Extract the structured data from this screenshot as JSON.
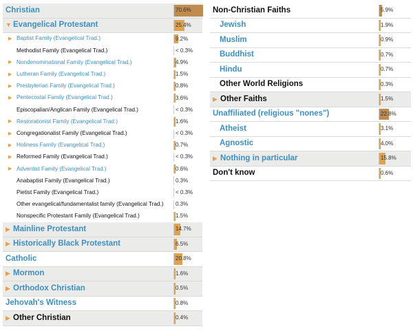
{
  "left_rows": [
    {
      "label": "Christian",
      "value": "70.6%",
      "pct": 70.6,
      "arrow": false,
      "style": "blue",
      "level": 0,
      "shaded": true,
      "bar": "dark"
    },
    {
      "label": "Evangelical Protestant",
      "value": "25.4%",
      "pct": 25.4,
      "arrow": true,
      "arrow_glyph": "▼",
      "style": "blue",
      "level": 0,
      "shaded": true,
      "bar": "light"
    },
    {
      "label": "Baptist Family (Evangelical Trad.)",
      "value": "9.2%",
      "pct": 9.2,
      "arrow": true,
      "arrow_glyph": "▶",
      "style": "blue",
      "level": 1,
      "shaded": false,
      "bar": "light"
    },
    {
      "label": "Methodist Family (Evangelical Trad.)",
      "value": "< 0.3%",
      "pct": 0.1,
      "arrow": false,
      "style": "black",
      "level": 1,
      "shaded": false,
      "bar": "none"
    },
    {
      "label": "Nondenominational Family (Evangelical Trad.)",
      "value": "4.9%",
      "pct": 4.9,
      "arrow": true,
      "arrow_glyph": "▶",
      "style": "blue",
      "level": 1,
      "shaded": false,
      "bar": "light"
    },
    {
      "label": "Lutheran Family (Evangelical Trad.)",
      "value": "1.5%",
      "pct": 1.5,
      "arrow": true,
      "arrow_glyph": "▶",
      "style": "blue",
      "level": 1,
      "shaded": false,
      "bar": "light"
    },
    {
      "label": "Presbyterian Family (Evangelical Trad.)",
      "value": "0.8%",
      "pct": 0.8,
      "arrow": true,
      "arrow_glyph": "▶",
      "style": "blue",
      "level": 1,
      "shaded": false,
      "bar": "light"
    },
    {
      "label": "Pentecostal Family (Evangelical Trad.)",
      "value": "3.6%",
      "pct": 3.6,
      "arrow": true,
      "arrow_glyph": "▶",
      "style": "blue",
      "level": 1,
      "shaded": false,
      "bar": "light"
    },
    {
      "label": "Episcopalian/Anglican Family (Evangelical Trad.)",
      "value": "< 0.3%",
      "pct": 0.1,
      "arrow": false,
      "style": "black",
      "level": 1,
      "shaded": false,
      "bar": "none"
    },
    {
      "label": "Restorationist Family (Evangelical Trad.)",
      "value": "1.6%",
      "pct": 1.6,
      "arrow": true,
      "arrow_glyph": "▶",
      "style": "blue",
      "level": 1,
      "shaded": false,
      "bar": "light"
    },
    {
      "label": "Congregationalist Family (Evangelical Trad.)",
      "value": "< 0.3%",
      "pct": 0.1,
      "arrow": true,
      "arrow_glyph": "▶",
      "style": "black",
      "level": 1,
      "shaded": false,
      "bar": "none"
    },
    {
      "label": "Holiness Family (Evangelical Trad.)",
      "value": "0.7%",
      "pct": 0.7,
      "arrow": true,
      "arrow_glyph": "▶",
      "style": "blue",
      "level": 1,
      "shaded": false,
      "bar": "light"
    },
    {
      "label": "Reformed Family (Evangelical Trad.)",
      "value": "< 0.3%",
      "pct": 0.1,
      "arrow": true,
      "arrow_glyph": "▶",
      "style": "black",
      "level": 1,
      "shaded": false,
      "bar": "none"
    },
    {
      "label": "Adventist Family (Evangelical Trad.)",
      "value": "0.6%",
      "pct": 0.6,
      "arrow": true,
      "arrow_glyph": "▶",
      "style": "blue",
      "level": 1,
      "shaded": false,
      "bar": "light"
    },
    {
      "label": "Anabaptist Family (Evangelical Trad.)",
      "value": "0.3%",
      "pct": 0.3,
      "arrow": false,
      "style": "black",
      "level": 1,
      "shaded": false,
      "bar": "none"
    },
    {
      "label": "Pietist Family (Evangelical Trad.)",
      "value": "< 0.3%",
      "pct": 0.1,
      "arrow": false,
      "style": "black",
      "level": 1,
      "shaded": false,
      "bar": "none"
    },
    {
      "label": "Other evangelical/fundamentalist family (Evangelical Trad.)",
      "value": "0.3%",
      "pct": 0.3,
      "arrow": false,
      "style": "black",
      "level": 1,
      "shaded": false,
      "bar": "none"
    },
    {
      "label": "Nonspecific Protestant Family (Evangelical Trad.)",
      "value": "1.5%",
      "pct": 1.5,
      "arrow": false,
      "style": "black",
      "level": 1,
      "shaded": false,
      "bar": "light"
    },
    {
      "label": "Mainline Protestant",
      "value": "14.7%",
      "pct": 14.7,
      "arrow": true,
      "arrow_glyph": "▶",
      "style": "blue",
      "level": 0,
      "shaded": true,
      "bar": "light"
    },
    {
      "label": "Historically Black Protestant",
      "value": "6.5%",
      "pct": 6.5,
      "arrow": true,
      "arrow_glyph": "▶",
      "style": "blue",
      "level": 0,
      "shaded": true,
      "bar": "light"
    },
    {
      "label": "Catholic",
      "value": "20.8%",
      "pct": 20.8,
      "arrow": false,
      "style": "blue",
      "level": 0,
      "shaded": false,
      "bar": "light"
    },
    {
      "label": "Mormon",
      "value": "1.6%",
      "pct": 1.6,
      "arrow": true,
      "arrow_glyph": "▶",
      "style": "blue",
      "level": 0,
      "shaded": true,
      "bar": "light"
    },
    {
      "label": "Orthodox Christian",
      "value": "0.5%",
      "pct": 0.5,
      "arrow": true,
      "arrow_glyph": "▶",
      "style": "blue",
      "level": 0,
      "shaded": true,
      "bar": "light"
    },
    {
      "label": "Jehovah's Witness",
      "value": "0.8%",
      "pct": 0.8,
      "arrow": false,
      "style": "blue",
      "level": 0,
      "shaded": false,
      "bar": "light"
    },
    {
      "label": "Other Christian",
      "value": "0.4%",
      "pct": 0.4,
      "arrow": true,
      "arrow_glyph": "▶",
      "style": "black",
      "level": 0,
      "shaded": true,
      "bar": "light"
    }
  ],
  "right_rows": [
    {
      "label": "Non-Christian Faiths",
      "value": "5.9%",
      "pct": 5.9,
      "arrow": false,
      "style": "black",
      "level": 0,
      "indent": 0,
      "shaded": false,
      "bar": "dark"
    },
    {
      "label": "Jewish",
      "value": "1.9%",
      "pct": 1.9,
      "arrow": false,
      "style": "blue",
      "level": 0,
      "indent": 1,
      "shaded": false,
      "bar": "light"
    },
    {
      "label": "Muslim",
      "value": "0.9%",
      "pct": 0.9,
      "arrow": false,
      "style": "blue",
      "level": 0,
      "indent": 1,
      "shaded": false,
      "bar": "light"
    },
    {
      "label": "Buddhist",
      "value": "0.7%",
      "pct": 0.7,
      "arrow": false,
      "style": "blue",
      "level": 0,
      "indent": 1,
      "shaded": false,
      "bar": "light"
    },
    {
      "label": "Hindu",
      "value": "0.7%",
      "pct": 0.7,
      "arrow": false,
      "style": "blue",
      "level": 0,
      "indent": 1,
      "shaded": false,
      "bar": "light"
    },
    {
      "label": "Other World Religions",
      "value": "0.3%",
      "pct": 0.3,
      "arrow": false,
      "style": "black",
      "level": 0,
      "indent": 1,
      "shaded": false,
      "bar": "light"
    },
    {
      "label": "Other Faiths",
      "value": "1.5%",
      "pct": 1.5,
      "arrow": true,
      "arrow_glyph": "▶",
      "style": "black",
      "level": 0,
      "indent": 0,
      "shaded": true,
      "bar": "light"
    },
    {
      "label": "Unaffiliated (religious \"nones\")",
      "value": "22.8%",
      "pct": 22.8,
      "arrow": false,
      "style": "blue",
      "level": 0,
      "indent": 0,
      "shaded": false,
      "bar": "dark"
    },
    {
      "label": "Atheist",
      "value": "3.1%",
      "pct": 3.1,
      "arrow": false,
      "style": "blue",
      "level": 0,
      "indent": 1,
      "shaded": false,
      "bar": "light"
    },
    {
      "label": "Agnostic",
      "value": "4.0%",
      "pct": 4.0,
      "arrow": false,
      "style": "blue",
      "level": 0,
      "indent": 1,
      "shaded": false,
      "bar": "light"
    },
    {
      "label": "Nothing in particular",
      "value": "15.8%",
      "pct": 15.8,
      "arrow": true,
      "arrow_glyph": "▶",
      "style": "blue",
      "level": 0,
      "indent": 0,
      "shaded": true,
      "bar": "light"
    },
    {
      "label": "Don't know",
      "value": "0.6%",
      "pct": 0.6,
      "arrow": false,
      "style": "black",
      "level": 0,
      "indent": 0,
      "shaded": false,
      "bar": "light"
    }
  ],
  "colors": {
    "link_blue": "#3d8fc4",
    "text_black": "#111111",
    "bar_light": "#e1a24f",
    "bar_dark": "#bf8b4f",
    "row_shade": "#ebebea"
  }
}
